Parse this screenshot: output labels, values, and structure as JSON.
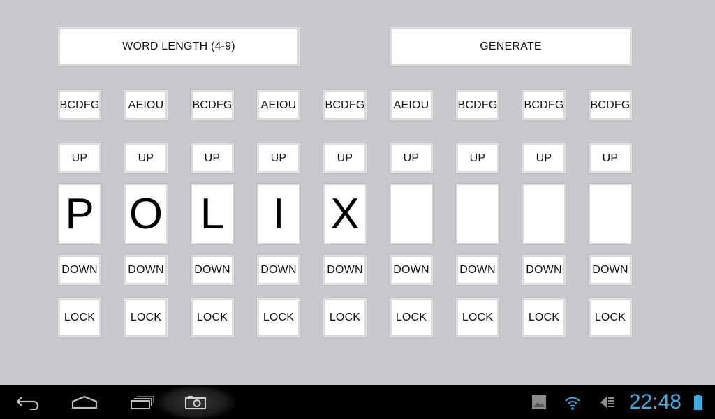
{
  "controls": {
    "word_length_label": "WORD LENGTH (4-9)",
    "generate_label": "GENERATE"
  },
  "columns": [
    {
      "category": "BCDFG",
      "up": "UP",
      "letter": "P",
      "down": "DOWN",
      "lock": "LOCK"
    },
    {
      "category": "AEIOU",
      "up": "UP",
      "letter": "O",
      "down": "DOWN",
      "lock": "LOCK"
    },
    {
      "category": "BCDFG",
      "up": "UP",
      "letter": "L",
      "down": "DOWN",
      "lock": "LOCK"
    },
    {
      "category": "AEIOU",
      "up": "UP",
      "letter": "I",
      "down": "DOWN",
      "lock": "LOCK"
    },
    {
      "category": "BCDFG",
      "up": "UP",
      "letter": "X",
      "down": "DOWN",
      "lock": "LOCK"
    },
    {
      "category": "AEIOU",
      "up": "UP",
      "letter": "",
      "down": "DOWN",
      "lock": "LOCK"
    },
    {
      "category": "BCDFG",
      "up": "UP",
      "letter": "",
      "down": "DOWN",
      "lock": "LOCK"
    },
    {
      "category": "BCDFG",
      "up": "UP",
      "letter": "",
      "down": "DOWN",
      "lock": "LOCK"
    },
    {
      "category": "BCDFG",
      "up": "UP",
      "letter": "",
      "down": "DOWN",
      "lock": "LOCK"
    }
  ],
  "system_bar": {
    "time": "22:48",
    "icons": [
      "back-icon",
      "home-icon",
      "recent-apps-icon",
      "screenshot-camera-icon",
      "gallery-notification-icon",
      "wifi-icon",
      "data-transfer-icon",
      "battery-icon"
    ],
    "accent_color": "#3cb0e6"
  },
  "colors": {
    "background": "#c9c9cb",
    "button": "#ffffff",
    "navbar": "#000000"
  }
}
